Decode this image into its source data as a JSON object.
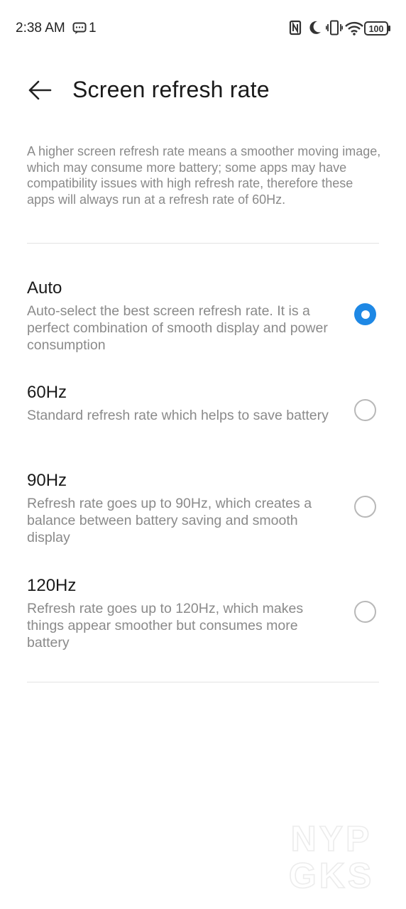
{
  "status_bar": {
    "time": "2:38 AM",
    "notification_count": "1",
    "battery": "100",
    "icons": [
      "message-icon",
      "nfc-icon",
      "moon-icon",
      "vibrate-icon",
      "wifi-icon",
      "battery-icon"
    ]
  },
  "header": {
    "title": "Screen refresh rate",
    "back_icon": "back-arrow-icon"
  },
  "description": "A higher screen refresh rate means a smoother moving image, which may consume more battery; some apps may have compatibility issues with high refresh rate, therefore these apps will always run at a refresh rate of 60Hz.",
  "options": [
    {
      "title": "Auto",
      "desc": "Auto-select the best screen refresh rate. It is a perfect combination of smooth display and power consumption",
      "selected": true
    },
    {
      "title": "60Hz",
      "desc": "Standard refresh rate which helps to save battery",
      "selected": false
    },
    {
      "title": "90Hz",
      "desc": "Refresh rate goes up to 90Hz, which creates a balance between battery saving and smooth display",
      "selected": false
    },
    {
      "title": "120Hz",
      "desc": "Refresh rate goes up to 120Hz, which makes things appear smoother but consumes more battery",
      "selected": false
    }
  ],
  "watermark": {
    "line1": "NYP",
    "line2": "GKS"
  },
  "colors": {
    "accent": "#1e88e5",
    "description_text": "#8a8a8a",
    "radio_off": "#b8b8b8"
  }
}
